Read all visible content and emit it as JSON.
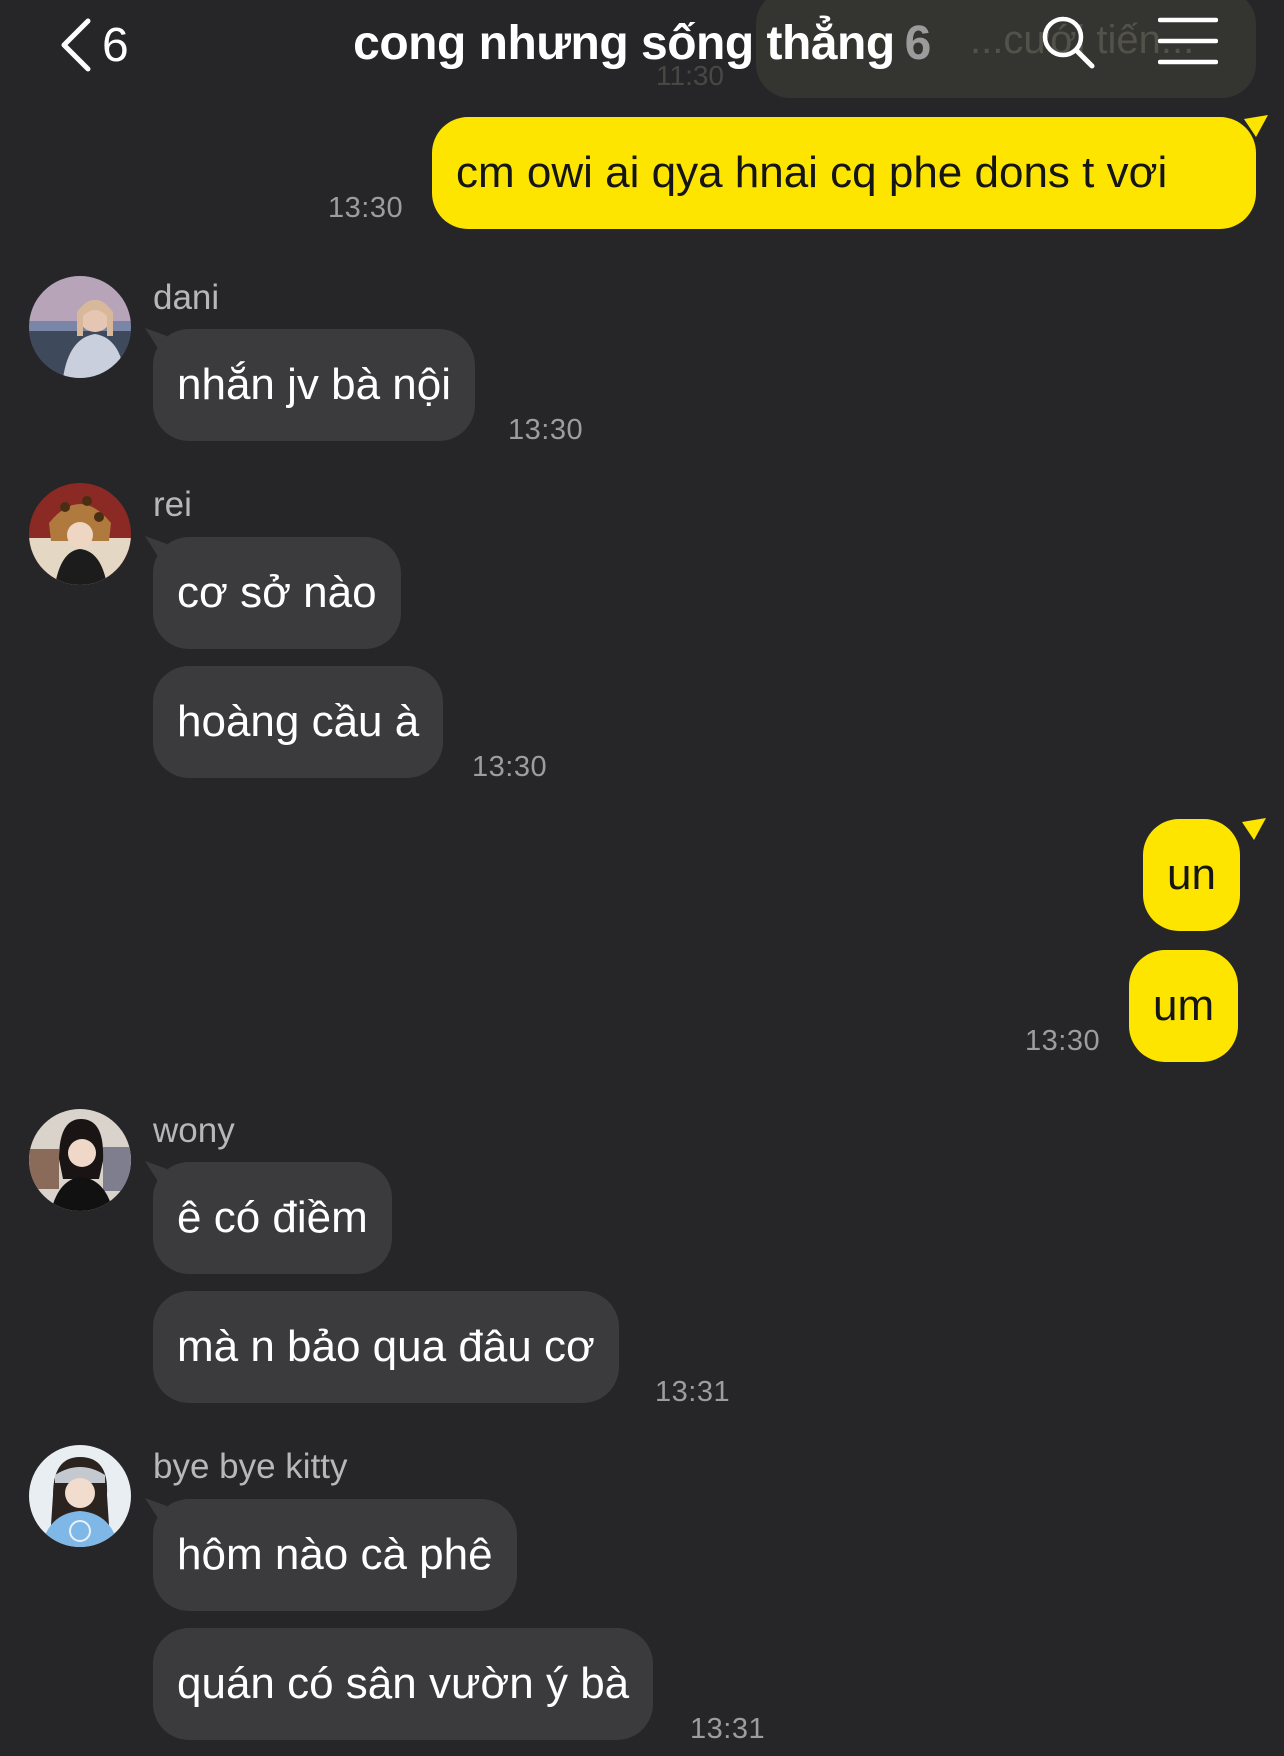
{
  "header": {
    "back_count": "6",
    "title": "cong nhưng sống thẳng",
    "member_count": "6",
    "icons": [
      "chevron-left-icon",
      "search-icon",
      "menu-icon"
    ]
  },
  "ghost_banner": {
    "text": "...cưới tiến...",
    "time": "11:30"
  },
  "colors": {
    "background": "#262628",
    "incoming_bubble": "#3b3b3d",
    "outgoing_bubble": "#fde500"
  },
  "messages": [
    {
      "text": "cm owi ai qya hnai cq phe dons t vơi",
      "time": "13:30"
    },
    {
      "sender": "dani",
      "text": "nhắn jv bà nội",
      "time": "13:30"
    },
    {
      "sender": "rei",
      "text": "cơ sở nào"
    },
    {
      "text": "hoàng cầu à",
      "time": "13:30"
    },
    {
      "text": "un"
    },
    {
      "text": "um",
      "time": "13:30"
    },
    {
      "sender": "wony",
      "text": "ê có điềm"
    },
    {
      "text": "mà n bảo qua đâu cơ",
      "time": "13:31"
    },
    {
      "sender": "bye bye kitty",
      "text": "hôm nào cà phê"
    },
    {
      "text": "quán có sân vườn ý bà",
      "time": "13:31"
    }
  ]
}
